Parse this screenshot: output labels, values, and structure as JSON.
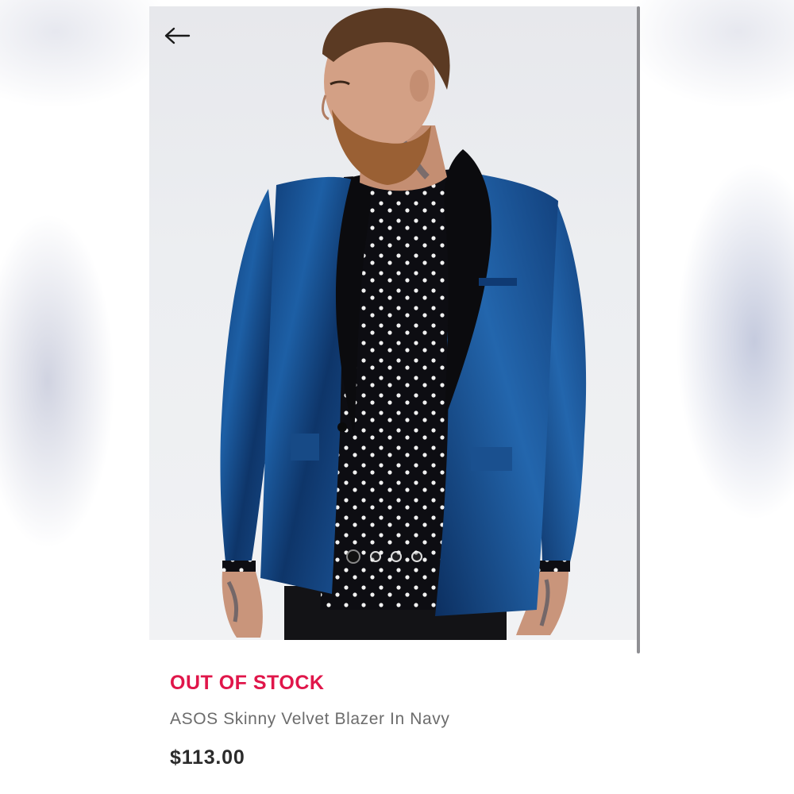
{
  "product": {
    "stock_status": "OUT OF STOCK",
    "name": "ASOS Skinny Velvet Blazer In Navy",
    "price": "$113.00"
  },
  "gallery": {
    "image_count": 4,
    "active_index": 0
  },
  "icons": {
    "back": "arrow-left-icon"
  },
  "colors": {
    "stock_status": "#e0164a",
    "price": "#2b2b2b",
    "title": "#6c6c6c",
    "blazer": "#1a4f8c"
  }
}
